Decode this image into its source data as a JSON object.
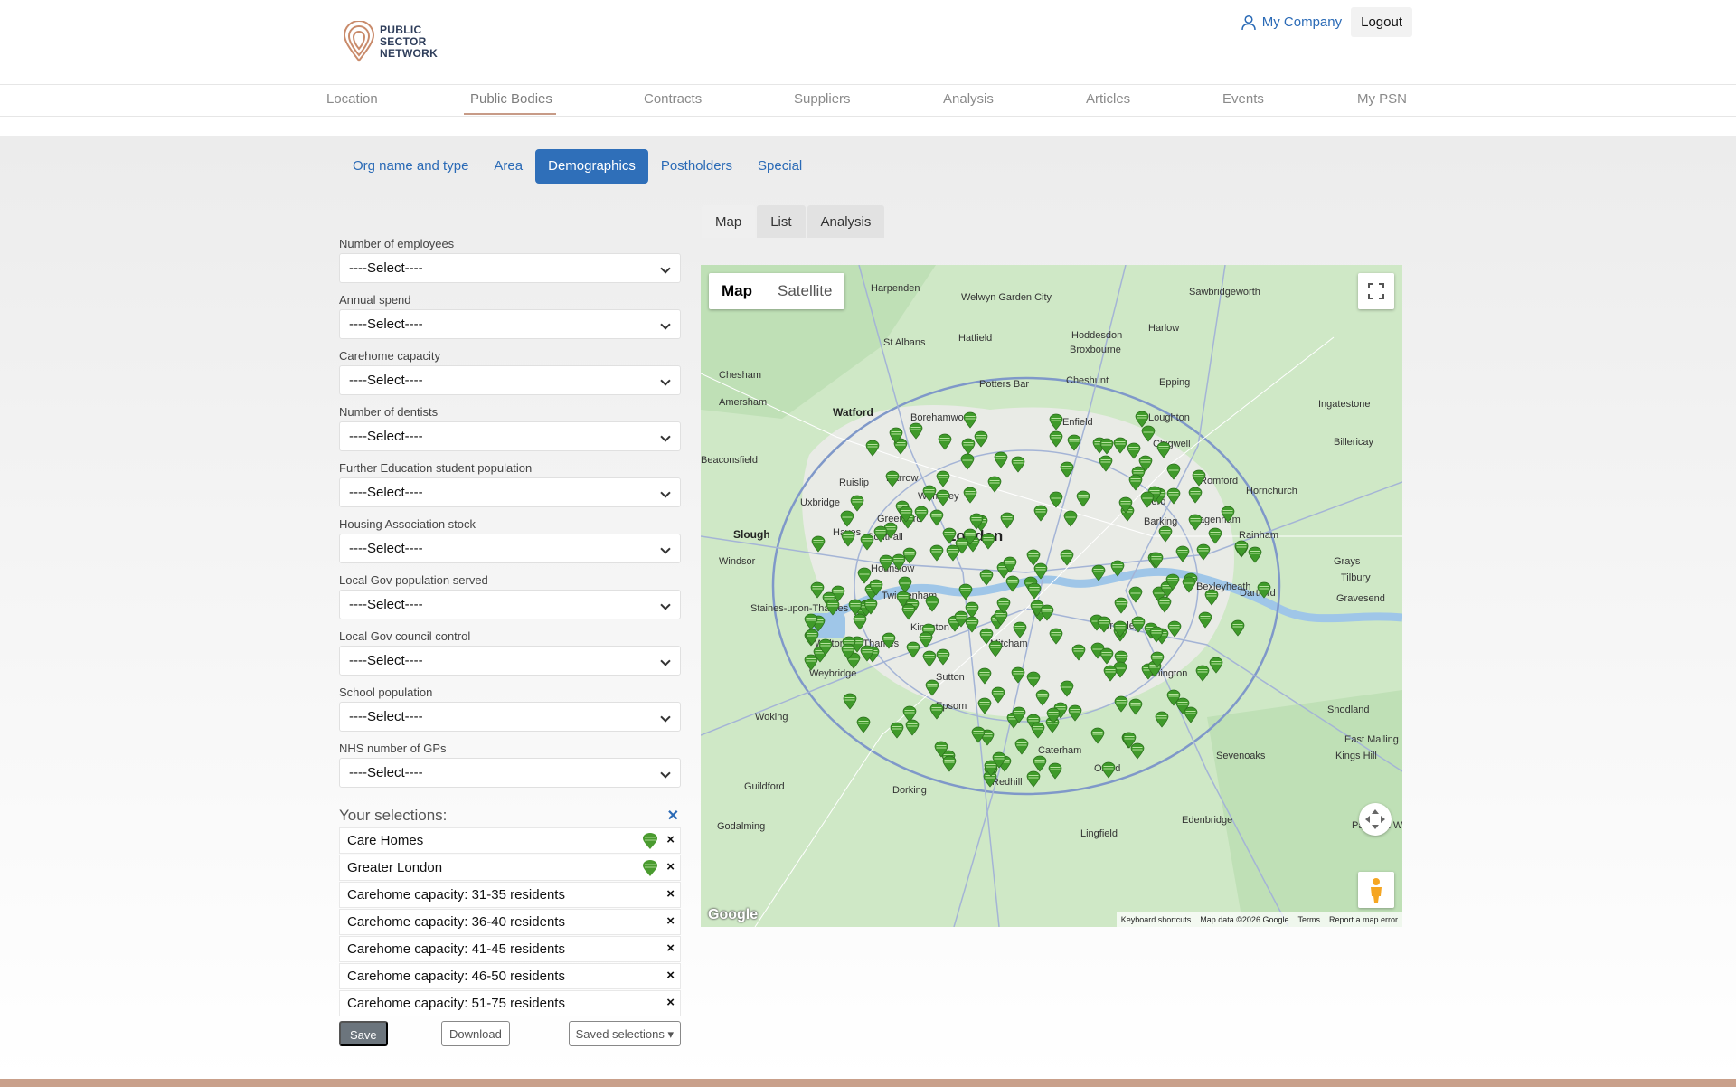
{
  "header": {
    "logo_lines": [
      "PUBLIC",
      "SECTOR",
      "NETWORK"
    ],
    "my_company": "My Company",
    "logout": "Logout"
  },
  "mainnav": {
    "items": [
      {
        "label": "Location",
        "active": false
      },
      {
        "label": "Public Bodies",
        "active": true
      },
      {
        "label": "Contracts",
        "active": false
      },
      {
        "label": "Suppliers",
        "active": false
      },
      {
        "label": "Analysis",
        "active": false
      },
      {
        "label": "Articles",
        "active": false
      },
      {
        "label": "Events",
        "active": false
      },
      {
        "label": "My PSN",
        "active": false
      }
    ]
  },
  "subtabs": [
    {
      "label": "Org name and type",
      "active": false
    },
    {
      "label": "Area",
      "active": false
    },
    {
      "label": "Demographics",
      "active": true
    },
    {
      "label": "Postholders",
      "active": false
    },
    {
      "label": "Special",
      "active": false
    }
  ],
  "viewtabs": [
    {
      "label": "Map",
      "active": true
    },
    {
      "label": "List",
      "active": false
    },
    {
      "label": "Analysis",
      "active": false
    }
  ],
  "filters": [
    {
      "label": "Number of employees",
      "value": "----Select----"
    },
    {
      "label": "Annual spend",
      "value": "----Select----"
    },
    {
      "label": "Carehome capacity",
      "value": "----Select----"
    },
    {
      "label": "Number of dentists",
      "value": "----Select----"
    },
    {
      "label": "Further Education student population",
      "value": "----Select----"
    },
    {
      "label": "Housing Association stock",
      "value": "----Select----"
    },
    {
      "label": "Local Gov population served",
      "value": "----Select----"
    },
    {
      "label": "Local Gov council control",
      "value": "----Select----"
    },
    {
      "label": "School population",
      "value": "----Select----"
    },
    {
      "label": "NHS number of GPs",
      "value": "----Select----"
    }
  ],
  "selections": {
    "title": "Your selections:",
    "clear_icon": "close-icon",
    "items": [
      {
        "label": "Care Homes",
        "has_pin": true
      },
      {
        "label": "Greater London",
        "has_pin": true
      },
      {
        "label": "Carehome capacity: 31-35 residents",
        "has_pin": false
      },
      {
        "label": "Carehome capacity: 36-40 residents",
        "has_pin": false
      },
      {
        "label": "Carehome capacity: 41-45 residents",
        "has_pin": false
      },
      {
        "label": "Carehome capacity: 46-50 residents",
        "has_pin": false
      },
      {
        "label": "Carehome capacity: 51-75 residents",
        "has_pin": false
      }
    ]
  },
  "actions": {
    "save": "Save",
    "download": "Download",
    "saved_selections": "Saved selections ▾"
  },
  "map": {
    "type_map": "Map",
    "type_satellite": "Satellite",
    "google": "Google",
    "attribution": [
      "Keyboard shortcuts",
      "Map data ©2026 Google",
      "Terms",
      "Report a map error"
    ],
    "places": [
      {
        "name": "London",
        "cls": "big"
      },
      {
        "name": "Watford",
        "cls": "med"
      },
      {
        "name": "Slough",
        "cls": "med"
      },
      {
        "name": "Harpenden",
        "cls": ""
      },
      {
        "name": "Welwyn Garden City",
        "cls": ""
      },
      {
        "name": "Hatfield",
        "cls": ""
      },
      {
        "name": "St Albans",
        "cls": ""
      },
      {
        "name": "Hoddesdon",
        "cls": ""
      },
      {
        "name": "Broxbourne",
        "cls": ""
      },
      {
        "name": "Harlow",
        "cls": ""
      },
      {
        "name": "Sawbridgeworth",
        "cls": ""
      },
      {
        "name": "Chesham",
        "cls": ""
      },
      {
        "name": "Amersham",
        "cls": ""
      },
      {
        "name": "Potters Bar",
        "cls": ""
      },
      {
        "name": "Cheshunt",
        "cls": ""
      },
      {
        "name": "Epping",
        "cls": ""
      },
      {
        "name": "Ingatestone",
        "cls": ""
      },
      {
        "name": "Borehamwood",
        "cls": ""
      },
      {
        "name": "Loughton",
        "cls": ""
      },
      {
        "name": "Enfield",
        "cls": ""
      },
      {
        "name": "Chigwell",
        "cls": ""
      },
      {
        "name": "Billericay",
        "cls": ""
      },
      {
        "name": "Beaconsfield",
        "cls": ""
      },
      {
        "name": "Ruislip",
        "cls": ""
      },
      {
        "name": "Harrow",
        "cls": ""
      },
      {
        "name": "Romford",
        "cls": ""
      },
      {
        "name": "Hornchurch",
        "cls": ""
      },
      {
        "name": "Wembley",
        "cls": ""
      },
      {
        "name": "Uxbridge",
        "cls": ""
      },
      {
        "name": "Ilford",
        "cls": ""
      },
      {
        "name": "Barking",
        "cls": ""
      },
      {
        "name": "Hayes",
        "cls": ""
      },
      {
        "name": "Southall",
        "cls": ""
      },
      {
        "name": "Greenford",
        "cls": ""
      },
      {
        "name": "Dagenham",
        "cls": ""
      },
      {
        "name": "Rainham",
        "cls": ""
      },
      {
        "name": "Windsor",
        "cls": ""
      },
      {
        "name": "Hounslow",
        "cls": ""
      },
      {
        "name": "Grays",
        "cls": ""
      },
      {
        "name": "Tilbury",
        "cls": ""
      },
      {
        "name": "Bexleyheath",
        "cls": ""
      },
      {
        "name": "Dartford",
        "cls": ""
      },
      {
        "name": "Gravesend",
        "cls": ""
      },
      {
        "name": "Staines-upon-Thames",
        "cls": ""
      },
      {
        "name": "Twickenham",
        "cls": ""
      },
      {
        "name": "Kingston",
        "cls": ""
      },
      {
        "name": "Walton-on-Thames",
        "cls": ""
      },
      {
        "name": "Mitcham",
        "cls": ""
      },
      {
        "name": "Bromley",
        "cls": ""
      },
      {
        "name": "Weybridge",
        "cls": ""
      },
      {
        "name": "Sutton",
        "cls": ""
      },
      {
        "name": "Orpington",
        "cls": ""
      },
      {
        "name": "Woking",
        "cls": ""
      },
      {
        "name": "Epsom",
        "cls": ""
      },
      {
        "name": "Snodland",
        "cls": ""
      },
      {
        "name": "East Malling",
        "cls": ""
      },
      {
        "name": "Caterham",
        "cls": ""
      },
      {
        "name": "Sevenoaks",
        "cls": ""
      },
      {
        "name": "Kings Hill",
        "cls": ""
      },
      {
        "name": "Oxted",
        "cls": ""
      },
      {
        "name": "Guildford",
        "cls": ""
      },
      {
        "name": "Dorking",
        "cls": ""
      },
      {
        "name": "Redhill",
        "cls": ""
      },
      {
        "name": "Edenbridge",
        "cls": ""
      },
      {
        "name": "Godalming",
        "cls": ""
      },
      {
        "name": "Lingfield",
        "cls": ""
      },
      {
        "name": "Paddock Wood",
        "cls": ""
      }
    ]
  }
}
